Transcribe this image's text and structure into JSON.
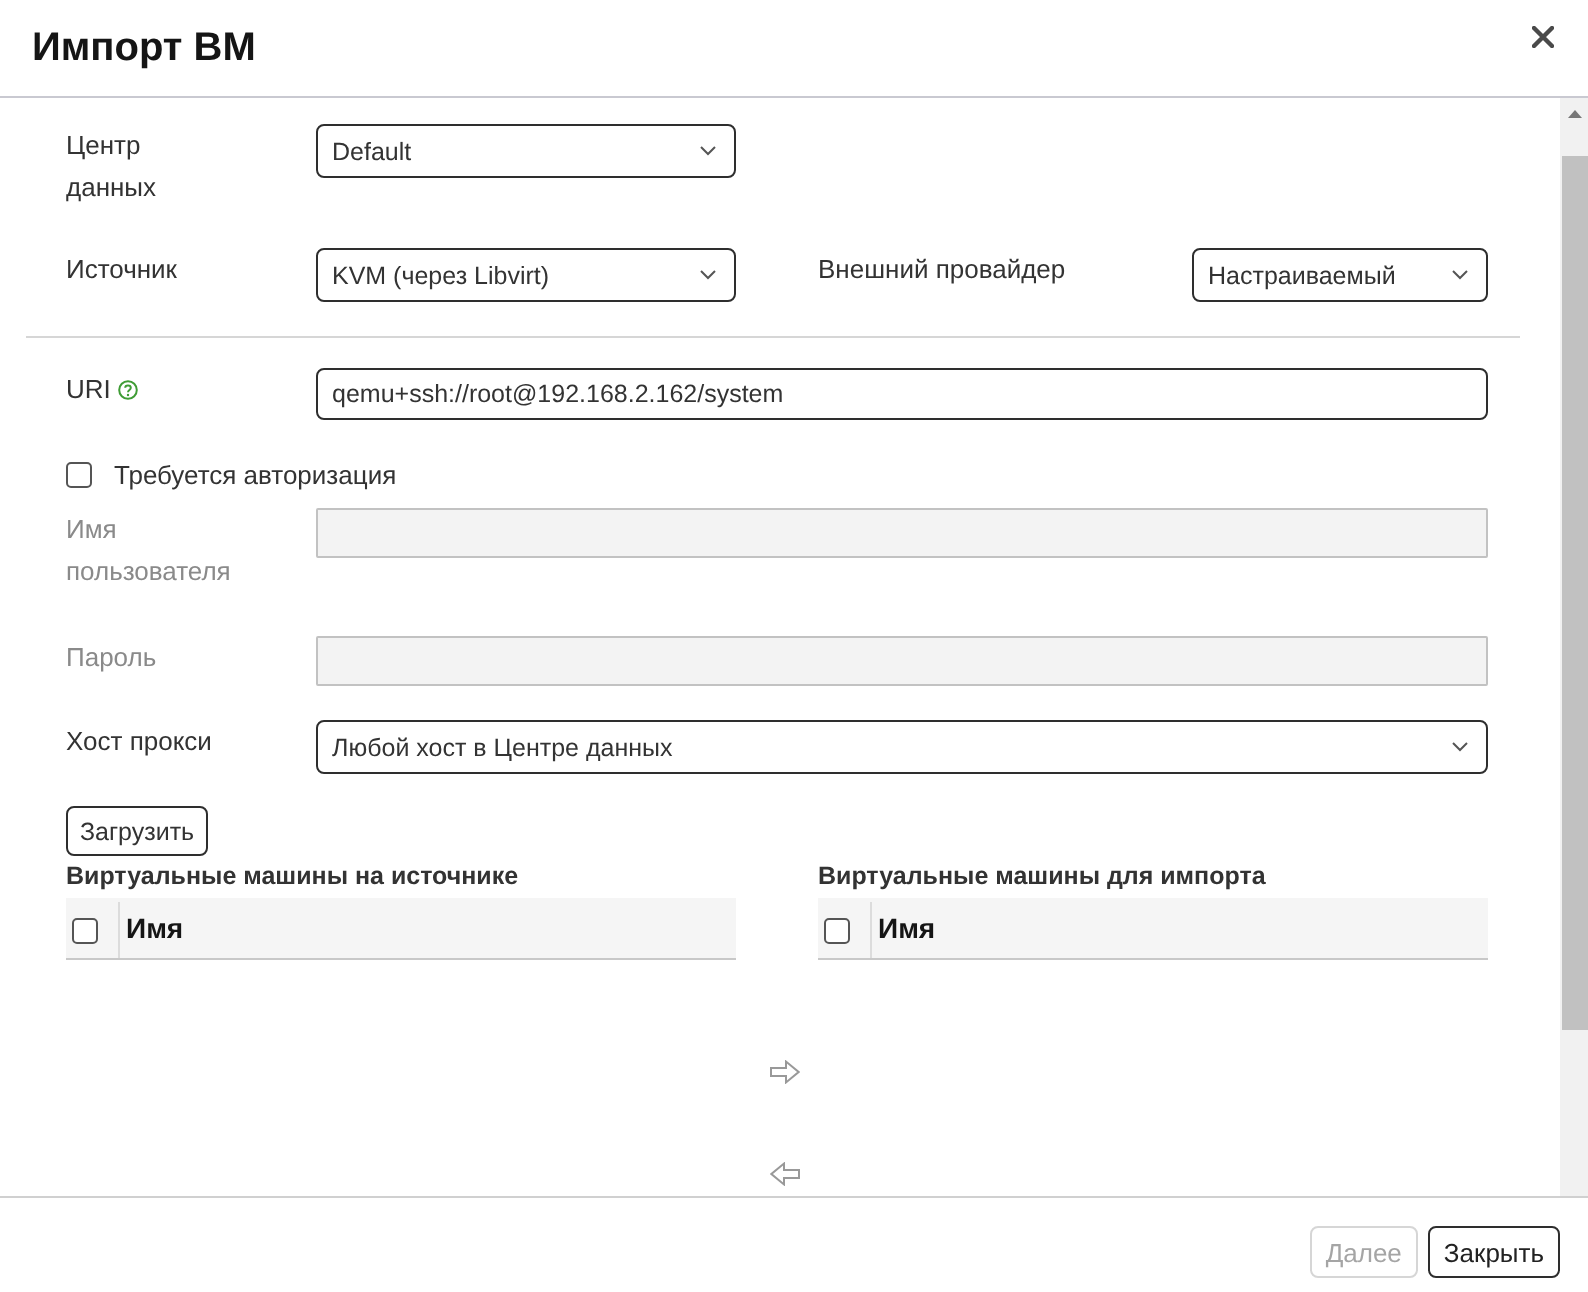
{
  "dialog": {
    "title": "Импорт ВМ"
  },
  "source_rows": [
    {
      "fields": [
        {
          "label": "Центр данных",
          "value": "Default"
        }
      ]
    },
    {
      "fields": [
        {
          "label": "Источник",
          "value": "KVM (через Libvirt)"
        },
        {
          "label": "Внешний провайдер",
          "value": "Настраиваемый"
        }
      ]
    }
  ],
  "connection_rows": [
    {
      "kind": "input",
      "label": "URI",
      "value": "qemu+ssh://root@192.168.2.162/system",
      "help": true,
      "disabled": false
    },
    {
      "kind": "checkbox",
      "label": "Требуется авторизация",
      "checked": false
    },
    {
      "kind": "input",
      "label": "Имя пользователя",
      "help": false,
      "disabled": true
    },
    {
      "kind": "password",
      "label": "Пароль",
      "help": false,
      "disabled": true
    },
    {
      "kind": "select",
      "label": "Хост прокси",
      "value": "Любой хост в Центре данных"
    }
  ],
  "load_button": {
    "label": "Загрузить"
  },
  "vm_lists": [
    {
      "title": "Виртуальные машины на источнике",
      "column": "Имя",
      "all_checked": false
    },
    {
      "title": "Виртуальные машины для импорта",
      "column": "Имя",
      "all_checked": false
    }
  ],
  "footer": {
    "buttons": [
      {
        "label": "Далее",
        "disabled": true
      },
      {
        "label": "Закрыть",
        "disabled": false
      }
    ]
  }
}
